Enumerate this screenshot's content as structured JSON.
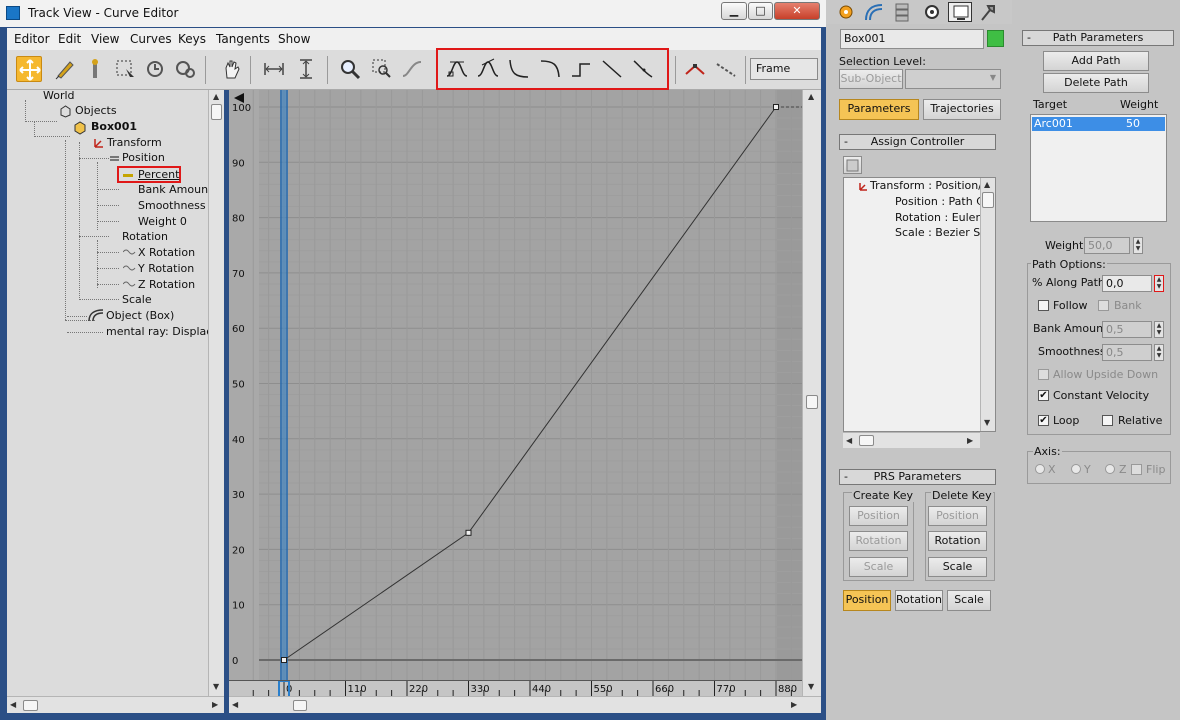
{
  "window": {
    "title": "Track View - Curve Editor",
    "min": "▁",
    "max": "□",
    "close": "✕"
  },
  "menu": [
    "Editor",
    "Edit",
    "View",
    "Curves",
    "Keys",
    "Tangents",
    "Show"
  ],
  "toolbar": {
    "frame_label": "Frame",
    "icons": [
      "move-keys-icon",
      "draw-curves-icon",
      "add-keys-icon",
      "region-select-icon",
      "retime-icon",
      "retime-all-icon",
      "pan-icon",
      "fit-horizontal-icon",
      "fit-vertical-icon",
      "zoom-icon",
      "zoom-region-icon",
      "isolate-curve-icon",
      "tangent-auto-icon",
      "tangent-custom-icon",
      "tangent-fast-icon",
      "tangent-slow-icon",
      "tangent-step-icon",
      "tangent-linear-icon",
      "tangent-smooth-icon",
      "break-tangents-icon",
      "unify-tangents-icon"
    ]
  },
  "tree": {
    "world": "World",
    "objects": "Objects",
    "box": "Box001",
    "transform": "Transform",
    "position": "Position",
    "percent": "Percent",
    "bank": "Bank Amount",
    "smooth": "Smoothness",
    "weight": "Weight 0",
    "rotation": "Rotation",
    "xrot": "X Rotation",
    "yrot": "Y Rotation",
    "zrot": "Z Rotation",
    "scale": "Scale",
    "objbox": "Object (Box)",
    "mental": "mental ray: Displacer"
  },
  "graph": {
    "y_labels": [
      "100",
      "90",
      "80",
      "70",
      "60",
      "50",
      "40",
      "30",
      "20",
      "10",
      "0"
    ],
    "x_labels": [
      "0",
      "110",
      "220",
      "330",
      "440",
      "550",
      "660",
      "770",
      "880"
    ],
    "curve_points": [
      [
        0,
        0
      ],
      [
        330,
        23
      ],
      [
        880,
        100
      ]
    ],
    "x_range": [
      0,
      880
    ],
    "y_range": [
      0,
      100
    ],
    "curve_color": "#333333",
    "timeslider_color": "#2a7fcc"
  },
  "cmd": {
    "tab_icons": [
      "create-icon",
      "modify-icon",
      "hierarchy-icon",
      "motion-icon",
      "display-icon",
      "utilities-icon"
    ],
    "object_name": "Box001",
    "object_color": "#3fbe44",
    "sel_level_label": "Selection Level:",
    "sub_object": "Sub-Object",
    "params_btn": "Parameters",
    "traj_btn": "Trajectories",
    "assign_ctrl": "Assign Controller",
    "ctrl_tree": [
      "Transform : Position/",
      "Position : Path Co",
      "Rotation : Euler X",
      "Scale : Bezier Sca"
    ],
    "prs": "PRS Parameters",
    "create_key": "Create Key",
    "delete_key": "Delete Key",
    "c_position": "Position",
    "c_rotation": "Rotation",
    "c_scale": "Scale",
    "d_position": "Position",
    "d_rotation": "Rotation",
    "d_scale": "Scale",
    "t_position": "Position",
    "t_rotation": "Rotation",
    "t_scale": "Scale",
    "path_params": "Path Parameters",
    "add_path": "Add Path",
    "delete_path": "Delete Path",
    "target_label": "Target",
    "weight_label": "Weight",
    "target_name": "Arc001",
    "target_weight": "50",
    "weight_field_label": "Weight:",
    "weight_value": "50,0",
    "path_options": "Path Options:",
    "along_label": "% Along Path:",
    "along_value": "0,0",
    "follow": "Follow",
    "bank": "Bank",
    "bank_amount_label": "Bank Amount:",
    "bank_amount_value": "0,5",
    "smooth_label": "Smoothness:",
    "smooth_value": "0,5",
    "upside": "Allow Upside Down",
    "const_vel": "Constant Velocity",
    "loop": "Loop",
    "relative": "Relative",
    "axis_label": "Axis:",
    "ax_x": "X",
    "ax_y": "Y",
    "ax_z": "Z",
    "flip": "Flip",
    "check": "✔"
  }
}
